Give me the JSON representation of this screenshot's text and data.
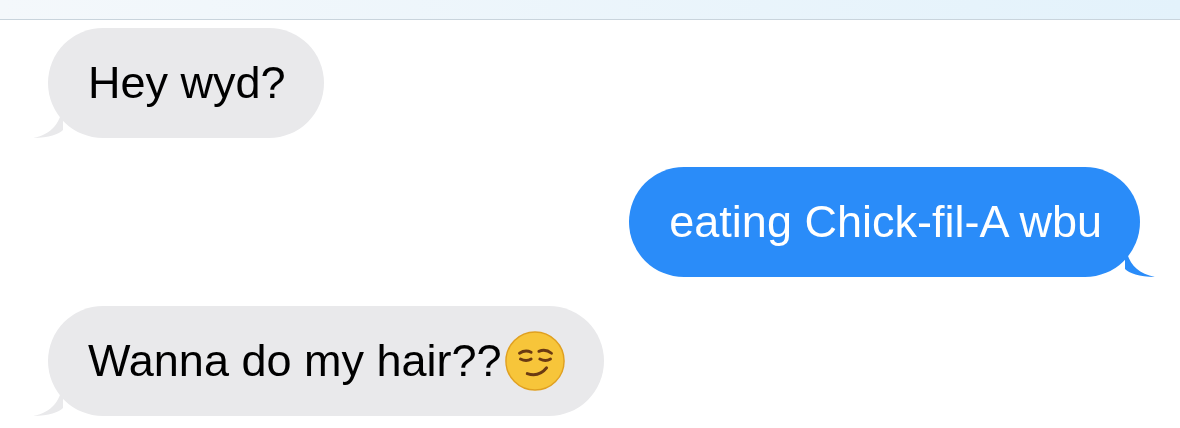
{
  "messages": [
    {
      "text": "Hey wyd?",
      "kind": "incoming",
      "emoji": false
    },
    {
      "text": "eating Chick-fil-A wbu",
      "kind": "outgoing",
      "emoji": false
    },
    {
      "text": "Wanna do my hair??",
      "kind": "incoming",
      "emoji": true
    }
  ]
}
